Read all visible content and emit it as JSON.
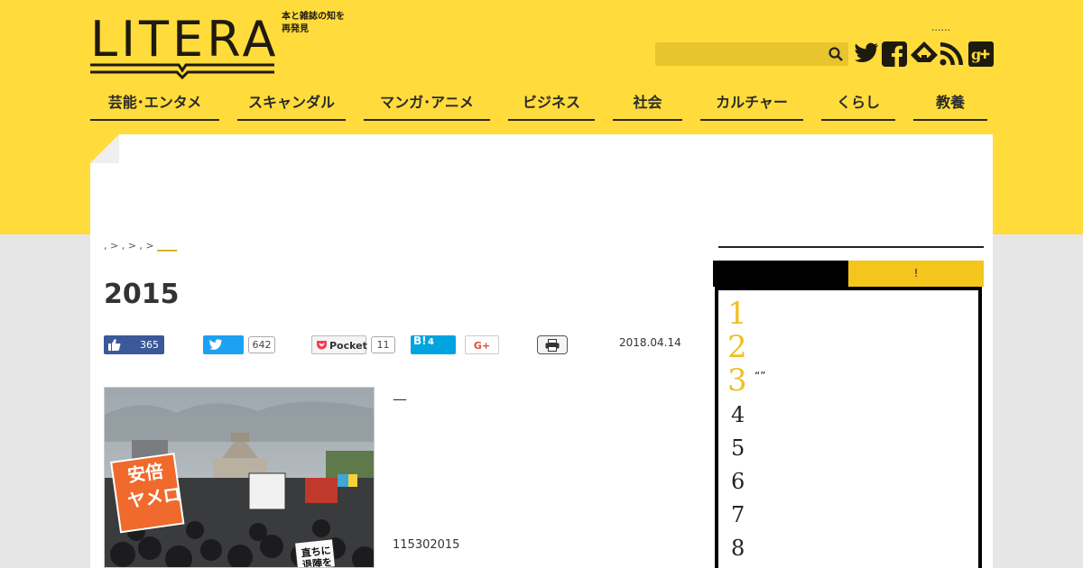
{
  "header": {
    "logo_text": "LITERA",
    "logo_tagline": "本と雑誌の知を再発見",
    "top_dots": "......",
    "search_placeholder": ""
  },
  "nav": [
    {
      "label": "芸能･エンタメ"
    },
    {
      "label": "スキャンダル"
    },
    {
      "label": "マンガ･アニメ"
    },
    {
      "label": "ビジネス"
    },
    {
      "label": "社会"
    },
    {
      "label": "カルチャー"
    },
    {
      "label": "くらし"
    },
    {
      "label": "教養"
    }
  ],
  "article": {
    "breadcrumb_prefix": ", > , > , >",
    "breadcrumb_current": "____",
    "title": "2015",
    "date": "2018.04.14",
    "excerpt_dash": "—",
    "excerpt_number": "115302015"
  },
  "share": {
    "facebook_count": "365",
    "twitter_count": "642",
    "pocket_label": "Pocket",
    "pocket_count": "11",
    "hatena_label": "B!",
    "hatena_count": "4",
    "gplus_label": "G+"
  },
  "photo": {
    "sign_abe": "安倍\nヤメロ",
    "sign_small": "直ちに\n退陣を"
  },
  "sidebar": {
    "tab_right": "!",
    "ranks": [
      "1",
      "2",
      "3",
      "4",
      "5",
      "6",
      "7",
      "8"
    ],
    "rank3_text": "“”"
  },
  "colors": {
    "brand_yellow": "#ffdc3c",
    "facebook": "#3b5998",
    "twitter": "#1da1f2",
    "hatena": "#00a4de",
    "pocket": "#ef4056"
  }
}
